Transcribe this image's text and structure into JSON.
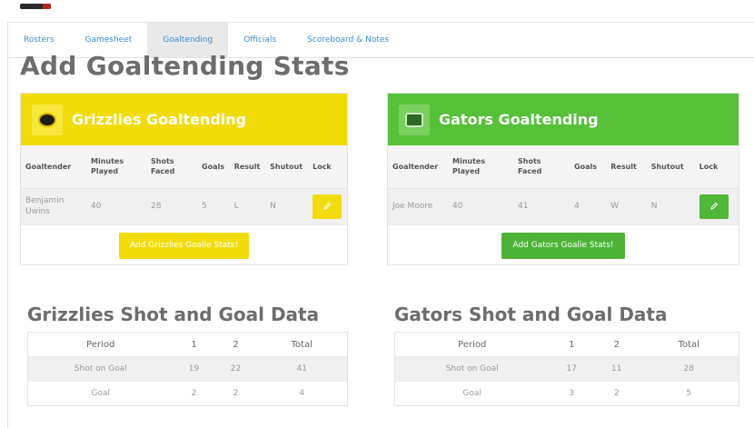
{
  "tabs": [
    "Rosters",
    "Gamesheet",
    "Goaltending",
    "Officials",
    "Scoreboard & Notes"
  ],
  "active_tab": "Goaltending",
  "page_title": "Add Goaltending Stats",
  "colors": {
    "home_accent": "#f1dc0a",
    "away_accent": "#56c039",
    "link": "#3b8ecb"
  },
  "goalie_columns": [
    "Goaltender",
    "Minutes Played",
    "Shots Faced",
    "Goals",
    "Result",
    "Shutout",
    "Lock"
  ],
  "home": {
    "card_title": "Grizzlies Goaltending",
    "goalie": {
      "name": "Benjamin Uwins",
      "minutes": "40",
      "shots": "28",
      "goals": "5",
      "result": "L",
      "shutout": "N"
    },
    "add_label": "Add Grizzlies Goalie Stats!",
    "shot_title": "Grizzlies Shot and Goal Data",
    "shot_header": [
      "Period",
      "1",
      "2",
      "Total"
    ],
    "shot_rows": [
      [
        "Shot on Goal",
        "19",
        "22",
        "41"
      ],
      [
        "Goal",
        "2",
        "2",
        "4"
      ]
    ]
  },
  "away": {
    "card_title": "Gators Goaltending",
    "goalie": {
      "name": "Joe Moore",
      "minutes": "40",
      "shots": "41",
      "goals": "4",
      "result": "W",
      "shutout": "N"
    },
    "add_label": "Add Gators Goalie Stats!",
    "shot_title": "Gators Shot and Goal Data",
    "shot_header": [
      "Period",
      "1",
      "2",
      "Total"
    ],
    "shot_rows": [
      [
        "Shot on Goal",
        "17",
        "11",
        "28"
      ],
      [
        "Goal",
        "3",
        "2",
        "5"
      ]
    ]
  },
  "icons": {
    "lock_button": "pencil-icon",
    "team_logo": "team-logo-icon"
  }
}
